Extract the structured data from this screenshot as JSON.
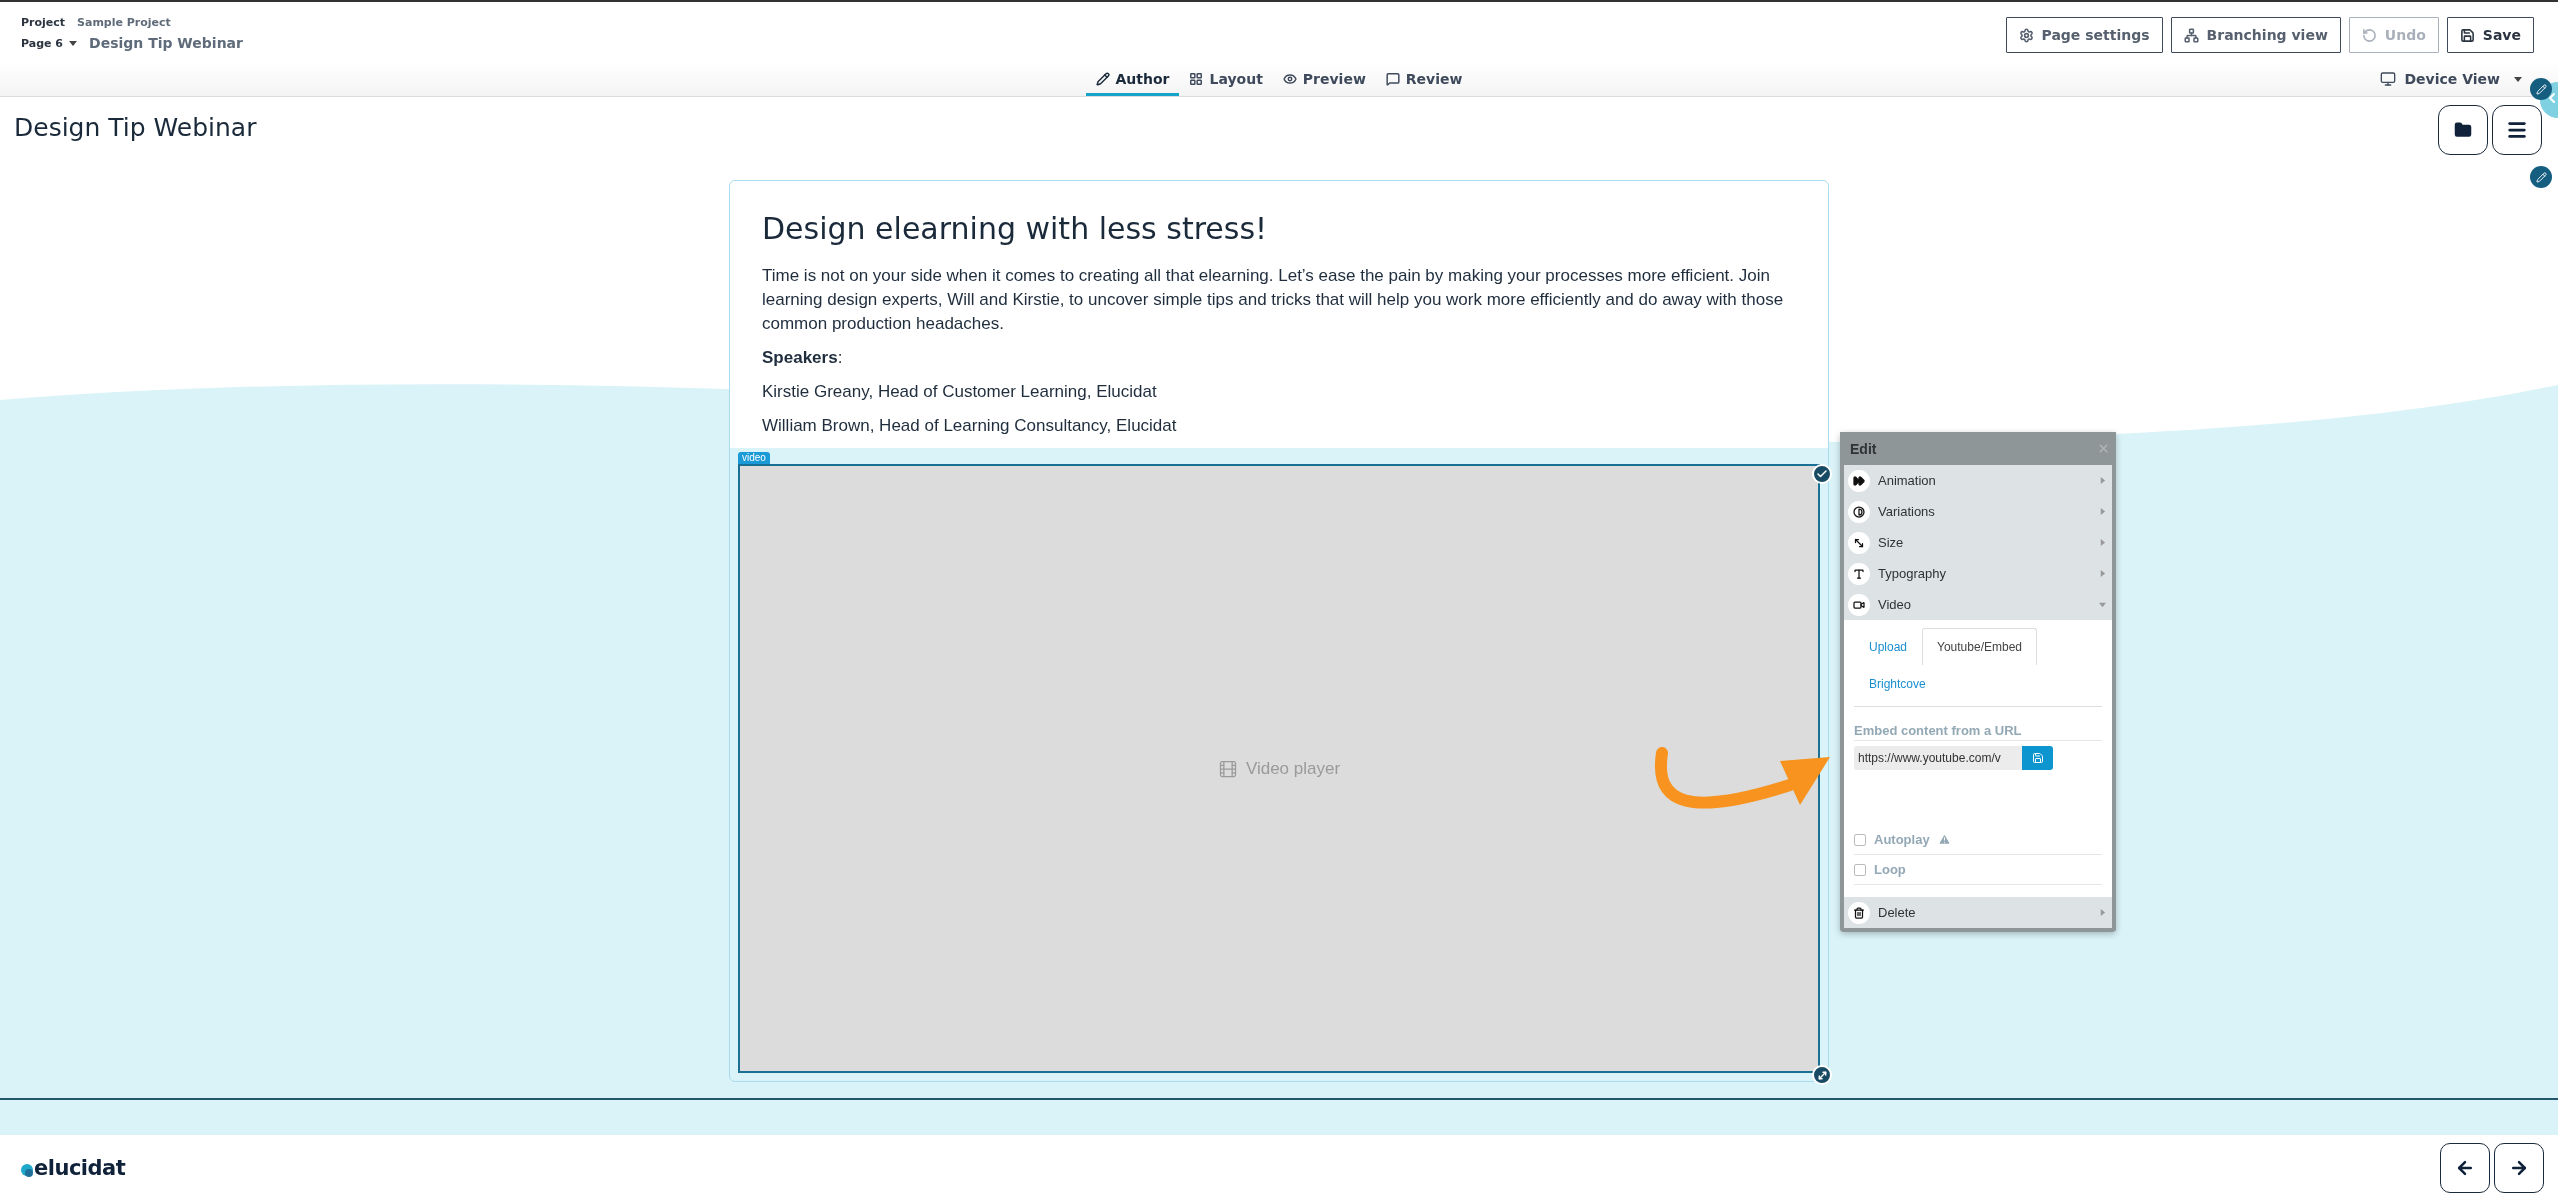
{
  "header": {
    "project_label": "Project",
    "project_name": "Sample Project",
    "page_label": "Page 6",
    "page_name": "Design Tip Webinar",
    "actions": [
      {
        "label": "Page settings",
        "kind": "settings",
        "disabled": false
      },
      {
        "label": "Branching view",
        "kind": "branching",
        "disabled": false
      },
      {
        "label": "Undo",
        "kind": "undo",
        "disabled": true
      },
      {
        "label": "Save",
        "kind": "save",
        "disabled": false
      }
    ]
  },
  "mode_tabs": [
    {
      "label": "Author",
      "kind": "author",
      "selected": true
    },
    {
      "label": "Layout",
      "kind": "layout",
      "selected": false
    },
    {
      "label": "Preview",
      "kind": "preview",
      "selected": false
    },
    {
      "label": "Review",
      "kind": "review",
      "selected": false
    }
  ],
  "device_view": "Device View",
  "page_title": "Design Tip Webinar",
  "content": {
    "heading": "Design elearning with less stress!",
    "paragraphs": [
      "Time is not on your side when it comes to creating all that elearning. Let’s ease the pain by making your processes more efficient. Join learning design experts, Will and Kirstie, to uncover simple tips and tricks that will help you work more efficiently and do away with those common production headaches.",
      "**Speakers**:",
      "Kirstie Greany, Head of Customer Learning, Elucidat",
      "William Brown, Head of Learning Consultancy, Elucidat"
    ]
  },
  "video": {
    "tag": "video",
    "placeholder_label": "Video player"
  },
  "edit_panel": {
    "title": "Edit",
    "sections": [
      {
        "label": "Animation",
        "kind": "animation",
        "expanded": false
      },
      {
        "label": "Variations",
        "kind": "variations",
        "expanded": false
      },
      {
        "label": "Size",
        "kind": "size",
        "expanded": false
      },
      {
        "label": "Typography",
        "kind": "typography",
        "expanded": false
      },
      {
        "label": "Video",
        "kind": "video",
        "expanded": true
      }
    ],
    "source_tabs": [
      {
        "label": "Upload",
        "selected": false
      },
      {
        "label": "Youtube/Embed",
        "selected": true
      },
      {
        "label": "Brightcove",
        "selected": false
      }
    ],
    "embed_label": "Embed content from a URL",
    "embed_url": "https://www.youtube.com/v",
    "options": [
      {
        "label": "Autoplay",
        "checked": false,
        "warning": true
      },
      {
        "label": "Loop",
        "checked": false,
        "warning": false
      }
    ],
    "delete_label": "Delete"
  },
  "footer": {
    "logo": "elucidat"
  }
}
